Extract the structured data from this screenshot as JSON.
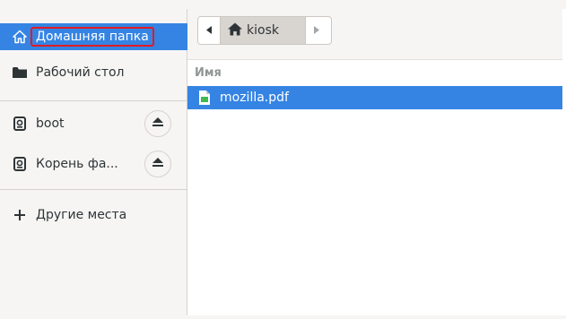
{
  "sidebar": {
    "items": [
      {
        "label": "Домашняя папка",
        "icon": "home-icon"
      },
      {
        "label": "Рабочий стол",
        "icon": "folder-icon"
      },
      {
        "label": "boot",
        "icon": "drive-icon"
      },
      {
        "label": "Корень фа...",
        "icon": "drive-icon"
      },
      {
        "label": "Другие места",
        "icon": "plus-icon"
      }
    ]
  },
  "pathbar": {
    "crumb_label": "kiosk"
  },
  "filelist": {
    "column_header": "Имя",
    "files": [
      {
        "name": "mozilla.pdf",
        "icon": "pdf-file-icon"
      }
    ]
  },
  "colors": {
    "selection": "#3584e4",
    "highlight_border": "#e01b24",
    "sidebar_bg": "#f6f5f4"
  }
}
